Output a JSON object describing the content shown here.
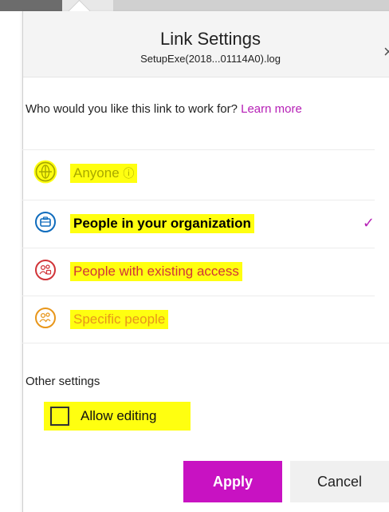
{
  "dialog": {
    "title": "Link Settings",
    "filename": "SetupExe(2018...01114A0).log",
    "close_glyph": "×"
  },
  "question": {
    "text": "Who would you like this link to work for?",
    "learn_more": "Learn more"
  },
  "options": [
    {
      "label": "Anyone",
      "info_glyph": "ⓘ",
      "icon": "globe-icon",
      "color": "#b8b800",
      "selected": false,
      "disabled": true
    },
    {
      "label": "People in your organization",
      "icon": "briefcase-icon",
      "color": "#0f6cbd",
      "selected": true,
      "disabled": false
    },
    {
      "label": "People with existing access",
      "icon": "people-icon",
      "color": "#d13438",
      "selected": false,
      "disabled": false
    },
    {
      "label": "Specific people",
      "icon": "people-icon",
      "color": "#e8961a",
      "selected": false,
      "disabled": false
    }
  ],
  "selected_check": "✓",
  "other_settings": {
    "title": "Other settings",
    "allow_editing": "Allow editing",
    "allow_editing_checked": false
  },
  "buttons": {
    "apply": "Apply",
    "cancel": "Cancel"
  },
  "colors": {
    "accent": "#c812c2",
    "highlight": "#ffff10"
  }
}
